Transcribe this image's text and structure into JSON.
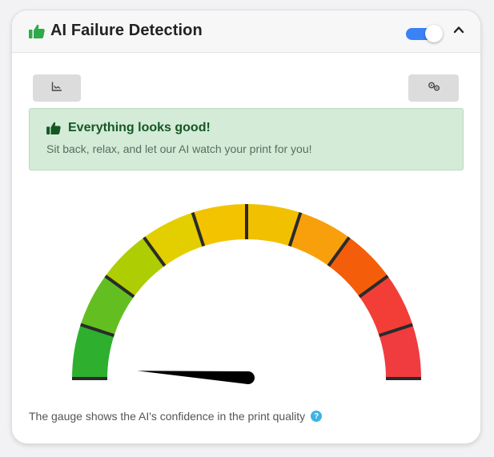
{
  "header": {
    "title": "AI Failure Detection",
    "title_icon": "thumbs-up-icon",
    "toggle_on": true,
    "collapse_icon": "chevron-up-icon"
  },
  "toolbar": {
    "left_icon": "chart-icon",
    "right_icon": "gears-icon"
  },
  "alert": {
    "icon": "thumbs-up-icon",
    "title": "Everything looks good!",
    "text": "Sit back, relax, and let our AI watch your print for you!"
  },
  "gauge": {
    "value_fraction": 0.02,
    "segment_colors": [
      "#2eaf2e",
      "#63bf21",
      "#aecd03",
      "#e3cf00",
      "#f3c300",
      "#f1c000",
      "#f7a00c",
      "#f45e0a",
      "#f23e37",
      "#f03c3f"
    ]
  },
  "footnote": {
    "text": "The gauge shows the AI's confidence in the print quality",
    "help_icon": "?"
  },
  "colors": {
    "accent": "#3b82f6",
    "success_bg": "#d4ebd8",
    "success_text": "#155724",
    "header_icon": "#2eaa4a"
  }
}
